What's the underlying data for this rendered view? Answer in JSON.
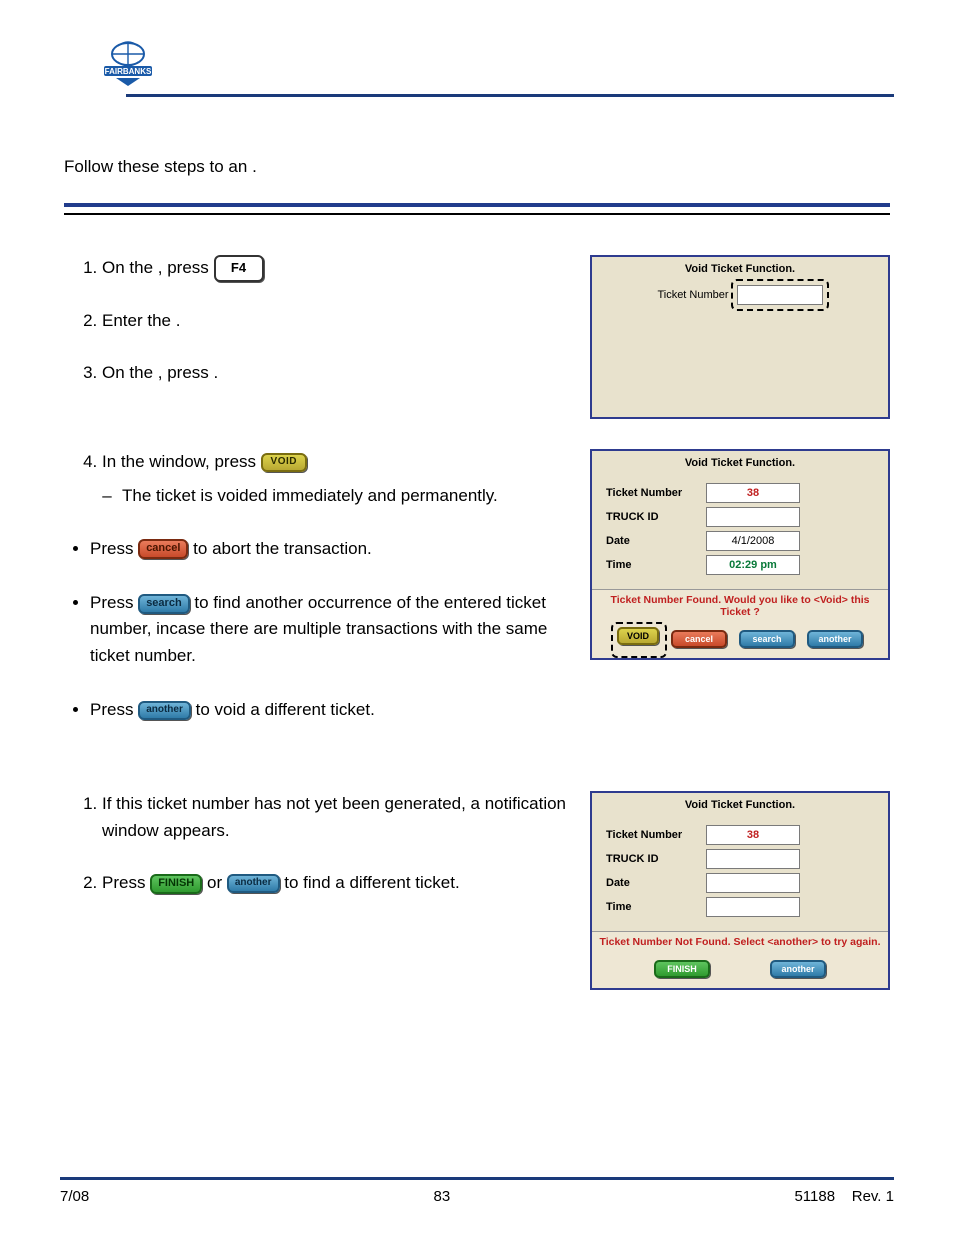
{
  "brand": "FAIRBANKS",
  "intro": {
    "pre": "Follow these steps to ",
    "mid": " an ",
    "end": "."
  },
  "steps": {
    "s1": {
      "pre": "On the ",
      "mid": ", press "
    },
    "s2": {
      "pre": "Enter the ",
      "end": "."
    },
    "s3": {
      "pre": "On the ",
      "mid": ", press ",
      "end": "."
    },
    "s4": {
      "pre": "In the ",
      "mid": " window, press "
    },
    "s4_note": "The ticket is voided immediately and permanently."
  },
  "bullets": {
    "b1": {
      "pre": "Press ",
      "post": " to abort the transaction."
    },
    "b2": {
      "pre": "Press ",
      "post": " to find another occurrence of the entered ticket number, incase there are multiple transactions with the same ticket number."
    },
    "b3": {
      "pre": "Press ",
      "post": " to void a different ticket."
    }
  },
  "section2": {
    "s1": "If this ticket number has not yet been generated, a notification window appears.",
    "s2_pre": "Press ",
    "s2_mid": " or ",
    "s2_post": " to find a different ticket."
  },
  "buttons": {
    "f4": "F4",
    "void": "VOID",
    "cancel": "cancel",
    "search": "search",
    "another": "another",
    "finish": "FINISH"
  },
  "panel1": {
    "title": "Void Ticket Function.",
    "lbl_ticket": "Ticket Number",
    "ticket": ""
  },
  "panel2": {
    "title": "Void Ticket Function.",
    "lbl_ticket": "Ticket Number",
    "ticket": "38",
    "lbl_truck": "TRUCK ID",
    "truck": "",
    "lbl_date": "Date",
    "date": "4/1/2008",
    "lbl_time": "Time",
    "time": "02:29 pm",
    "msg": "Ticket Number Found. Would you like to <Void> this Ticket ?",
    "btns": {
      "void": "VOID",
      "cancel": "cancel",
      "search": "search",
      "another": "another"
    }
  },
  "panel3": {
    "title": "Void Ticket Function.",
    "lbl_ticket": "Ticket Number",
    "ticket": "38",
    "lbl_truck": "TRUCK ID",
    "truck": "",
    "lbl_date": "Date",
    "date": "",
    "lbl_time": "Time",
    "time": "",
    "msg": "Ticket Number Not Found. Select <another> to try again.",
    "btns": {
      "finish": "FINISH",
      "another": "another"
    }
  },
  "footer": {
    "left": "7/08",
    "center": "83",
    "right_doc": "51188",
    "right_rev": "Rev. 1"
  }
}
